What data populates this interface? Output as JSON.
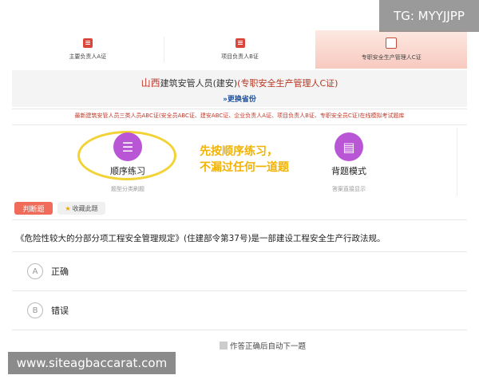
{
  "tabs": [
    {
      "label": "主要负责人A证",
      "active": false
    },
    {
      "label": "项目负责人B证",
      "active": false
    },
    {
      "label": "专职安全生产管理人C证",
      "active": true
    }
  ],
  "watermarks": {
    "tg": "TG: MYYJJPP",
    "site": "www.siteagbaccarat.com"
  },
  "header": {
    "region": "山西",
    "title": "建筑安管人员(建安)",
    "title_suffix": "(专职安全生产管理人C证)",
    "switch_label": "»更换省份",
    "subtitle": "最新建筑安管人员三类人员ABC证(安全员ABC证、建安ABC证、企业负责人A证、项目负责人B证、专职安全员C证)在线模拟考试题库"
  },
  "modes": [
    {
      "name": "顺序练习",
      "desc": "题型分类刷题",
      "icon": "list-icon"
    },
    {
      "name": "背题模式",
      "desc": "答案直接显示",
      "icon": "book-icon"
    }
  ],
  "hint": {
    "line1": "先按顺序练习，",
    "line2": "不漏过任何一道题"
  },
  "question": {
    "type_tag": "判断题",
    "fav_label": "收藏此题",
    "text": "《危险性较大的分部分项工程安全管理规定》(住建部令第37号)是一部建设工程安全生产行政法规。",
    "options": [
      {
        "letter": "A",
        "text": "正确"
      },
      {
        "letter": "B",
        "text": "错误"
      }
    ],
    "auto_next": "作答正确后自动下一题"
  },
  "colors": {
    "accent": "#b856d6",
    "red": "#c0392b",
    "hint": "#f2b300"
  }
}
